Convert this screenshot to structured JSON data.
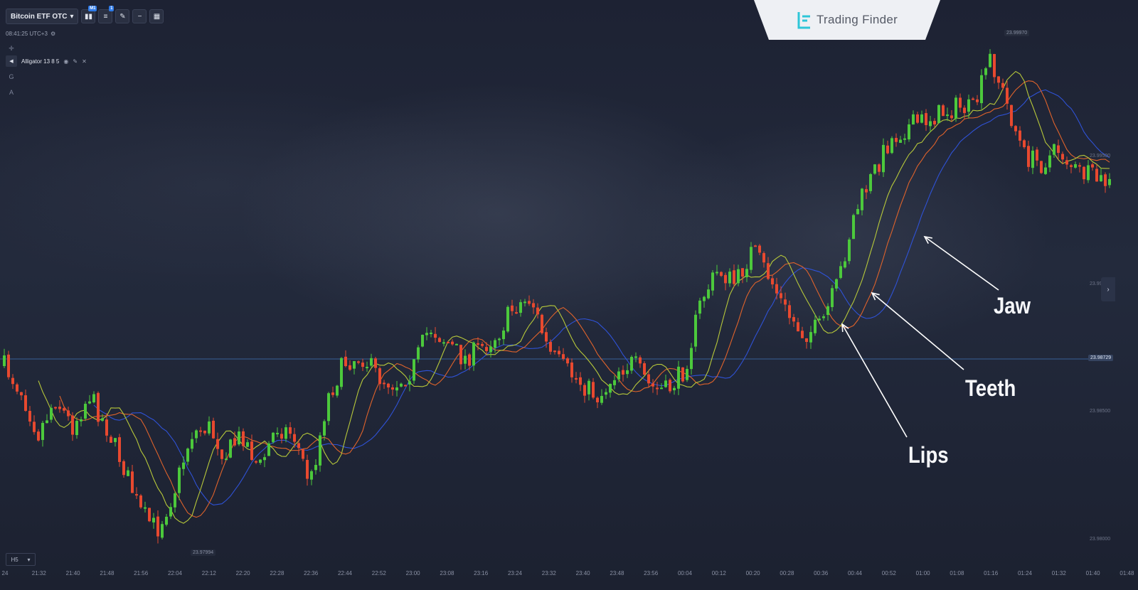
{
  "toolbar": {
    "asset_label": "Bitcoin ETF OTC",
    "chart_type_badge": "M1",
    "indicators_badge": "1",
    "icons": [
      "chart-type-icon",
      "indicators-icon",
      "drawing-icon",
      "minus-icon",
      "grid-layout-icon"
    ]
  },
  "clock": {
    "time": "08:41:25 UTC+3"
  },
  "side_tools": {
    "crosshair": "✛",
    "g_label": "G",
    "a_label": "A"
  },
  "indicator": {
    "label": "Alligator 13 8 5"
  },
  "logo": {
    "text": "Trading Finder"
  },
  "price_axis": {
    "labels": [
      "23.99970",
      "23.99500",
      "23.99",
      "23.98500",
      "23.98000"
    ],
    "current_price": "23.98729"
  },
  "extremes": {
    "high": "23.99970",
    "low": "23.97994"
  },
  "timeframe": {
    "value": "H5"
  },
  "time_axis": [
    "24",
    "21:32",
    "21:40",
    "21:48",
    "21:56",
    "22:04",
    "22:12",
    "22:20",
    "22:28",
    "22:36",
    "22:44",
    "22:52",
    "23:00",
    "23:08",
    "23:16",
    "23:24",
    "23:32",
    "23:40",
    "23:48",
    "23:56",
    "00:04",
    "00:12",
    "00:20",
    "00:28",
    "00:36",
    "00:44",
    "00:52",
    "01:00",
    "01:08",
    "01:16",
    "01:24",
    "01:32",
    "01:40",
    "01:48"
  ],
  "annotations": {
    "jaw": "Jaw",
    "teeth": "Teeth",
    "lips": "Lips"
  },
  "colors": {
    "bull": "#4cc93c",
    "bear": "#e8492f",
    "jaw": "#2f52d6",
    "teeth": "#e0632b",
    "lips": "#b7c83a",
    "current_line": "#3d6fb0"
  },
  "chart_data": {
    "type": "candlestick",
    "seed": 7,
    "path_y": [
      515,
      550,
      610,
      560,
      600,
      555,
      600,
      655,
      720,
      745,
      690,
      610,
      600,
      640,
      610,
      660,
      600,
      610,
      680,
      560,
      510,
      500,
      530,
      540,
      520,
      460,
      480,
      505,
      490,
      470,
      430,
      420,
      495,
      520,
      540,
      560,
      520,
      510,
      545,
      550,
      520,
      420,
      380,
      400,
      350,
      390,
      440,
      470,
      460,
      400,
      300,
      250,
      200,
      180,
      170,
      160,
      150,
      155,
      80,
      150,
      220,
      230,
      210,
      240,
      250,
      260
    ],
    "lo_price": 23.97994,
    "hi_price": 23.9997
  }
}
